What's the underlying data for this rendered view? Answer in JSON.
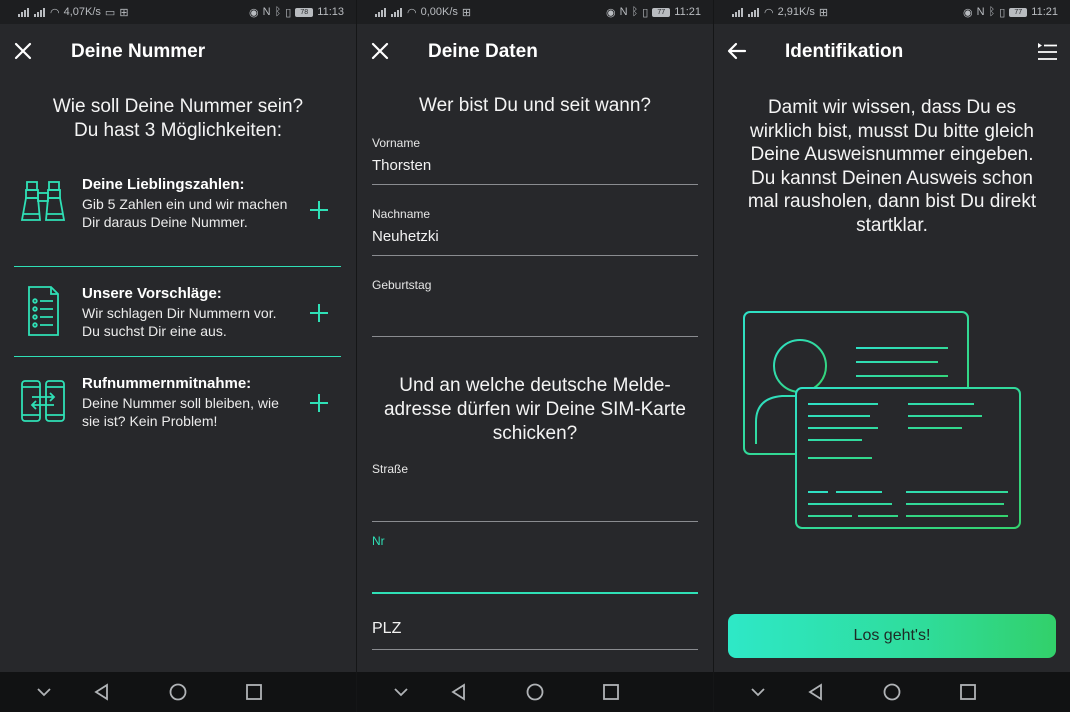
{
  "screens": [
    {
      "status": {
        "speed": "4,07K/s",
        "battery": "78",
        "time": "11:13"
      },
      "title": "Deine Nummer",
      "heading": [
        "Wie soll Deine Nummer sein?",
        "Du hast 3 Möglichkeiten:"
      ],
      "options": [
        {
          "title": "Deine Lieblingszahlen:",
          "desc": "Gib 5 Zahlen ein und wir machen Dir daraus Deine Nummer.",
          "icon": "binoculars-icon"
        },
        {
          "title": "Unsere Vorschläge:",
          "desc": "Wir schlagen Dir Nummern vor. Du suchst Dir eine aus.",
          "icon": "list-document-icon"
        },
        {
          "title": "Rufnummernmitnahme:",
          "desc": "Deine Nummer soll bleiben, wie sie ist? Kein Problem!",
          "icon": "phone-transfer-icon"
        }
      ]
    },
    {
      "status": {
        "speed": "0,00K/s",
        "battery": "77",
        "time": "11:21"
      },
      "title": "Deine Daten",
      "heading1": "Wer bist Du und seit wann?",
      "fields1": [
        {
          "label": "Vorname",
          "value": "Thorsten"
        },
        {
          "label": "Nachname",
          "value": "Neuhetzki"
        },
        {
          "label": "Geburtstag",
          "value": ""
        }
      ],
      "heading2": [
        "Und an welche deutsche Melde-",
        "adresse dürfen wir Deine SIM-Karte",
        "schicken?"
      ],
      "fields2": [
        {
          "label": "Straße",
          "value": ""
        },
        {
          "label": "Nr",
          "value": ""
        }
      ],
      "plz_placeholder": "PLZ"
    },
    {
      "status": {
        "speed": "2,91K/s",
        "battery": "77",
        "time": "11:21"
      },
      "title": "Identifikation",
      "heading": [
        "Damit wir wissen, dass Du es",
        "wirklich bist, musst Du bitte gleich",
        "Deine Ausweisnummer eingeben.",
        "Du kannst Deinen Ausweis schon",
        "mal rausholen, dann bist Du direkt",
        "startklar."
      ],
      "cta": "Los geht's!"
    }
  ],
  "colors": {
    "accent": "#2fe0b6",
    "background": "#27282b",
    "navbar": "#111213"
  }
}
